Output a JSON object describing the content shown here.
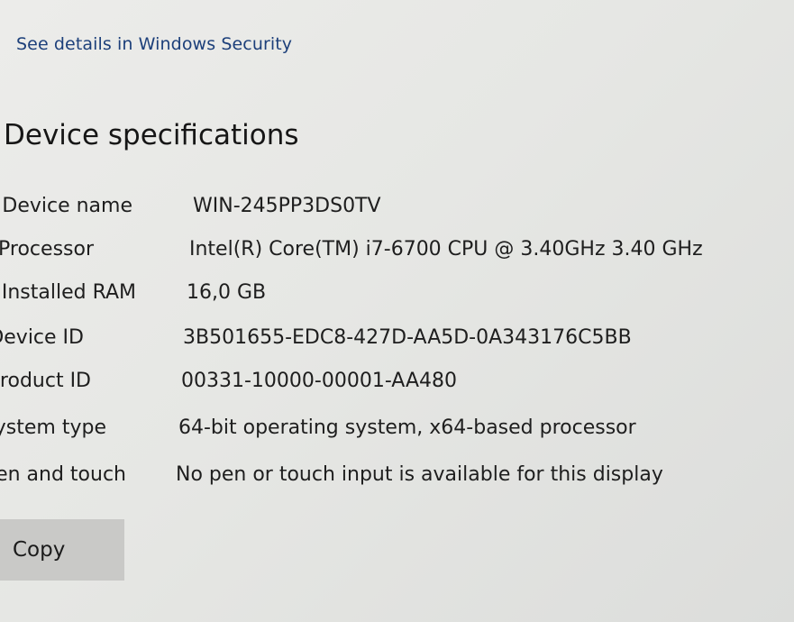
{
  "security_link": "See details in Windows Security",
  "section_title": "Device specifications",
  "specs": [
    {
      "label": "Device name",
      "value": "WIN-245PP3DS0TV"
    },
    {
      "label": "Processor",
      "value": "Intel(R) Core(TM) i7-6700 CPU @ 3.40GHz   3.40 GHz"
    },
    {
      "label": "Installed RAM",
      "value": "16,0 GB"
    },
    {
      "label": "Device ID",
      "value": "3B501655-EDC8-427D-AA5D-0A343176C5BB"
    },
    {
      "label": "Product ID",
      "value": "00331-10000-00001-AA480"
    },
    {
      "label": "System type",
      "value": "64-bit operating system, x64-based processor"
    },
    {
      "label": "Pen and touch",
      "value": "No pen or touch input is available for this display"
    }
  ],
  "copy_button": "Copy"
}
